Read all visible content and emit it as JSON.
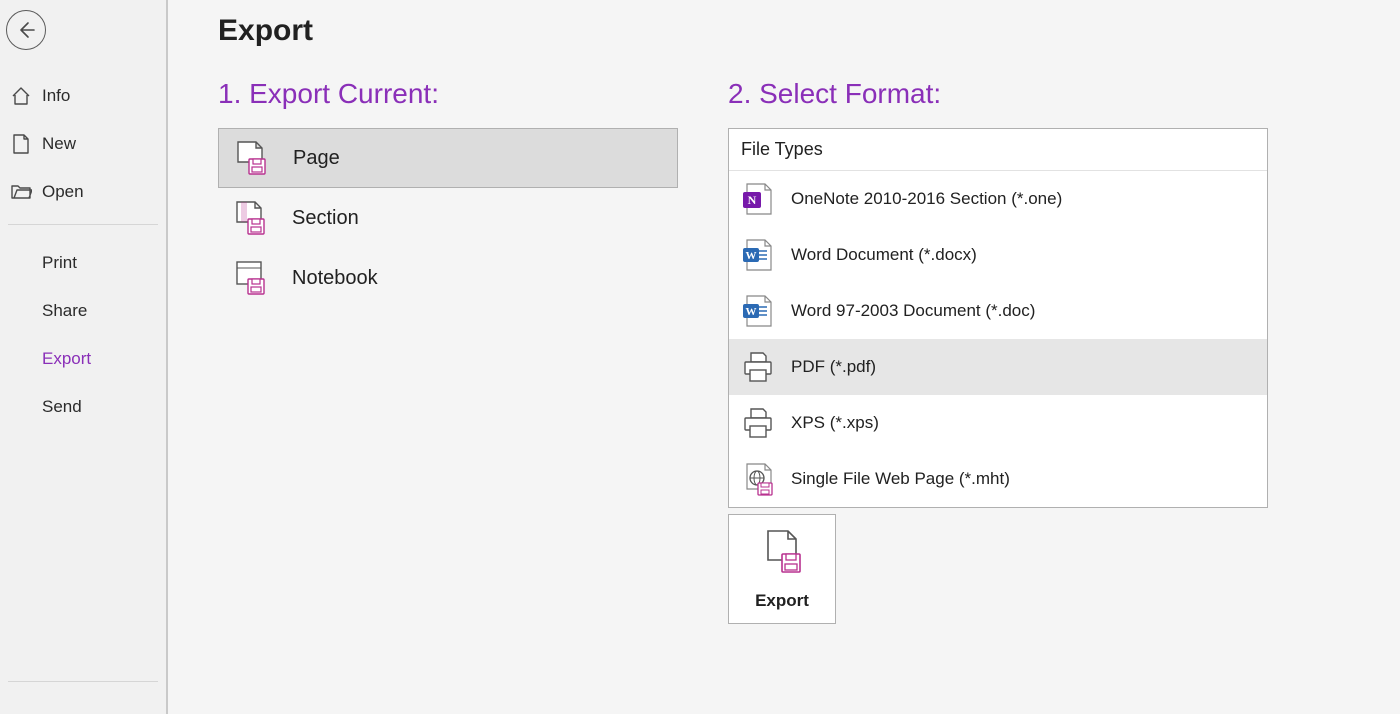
{
  "colors": {
    "accent": "#8a2fb8",
    "save_badge": "#b8318f",
    "word_blue": "#2b6ab4",
    "onenote_purple": "#7719aa"
  },
  "sidebar": {
    "items": [
      {
        "key": "info",
        "label": "Info",
        "icon": "home-icon",
        "indented": false
      },
      {
        "key": "new",
        "label": "New",
        "icon": "page-icon",
        "indented": false
      },
      {
        "key": "open",
        "label": "Open",
        "icon": "folder-icon",
        "indented": false
      },
      {
        "key": "print",
        "label": "Print",
        "icon": null,
        "indented": true
      },
      {
        "key": "share",
        "label": "Share",
        "icon": null,
        "indented": true
      },
      {
        "key": "export",
        "label": "Export",
        "icon": null,
        "indented": true,
        "active": true
      },
      {
        "key": "send",
        "label": "Send",
        "icon": null,
        "indented": true
      }
    ]
  },
  "page": {
    "title": "Export",
    "step1": {
      "heading": "1. Export Current:"
    },
    "step2": {
      "heading": "2. Select Format:",
      "group_label": "File Types"
    },
    "export_button_label": "Export"
  },
  "export_scopes": [
    {
      "key": "page",
      "label": "Page",
      "selected": true
    },
    {
      "key": "section",
      "label": "Section",
      "selected": false
    },
    {
      "key": "notebook",
      "label": "Notebook",
      "selected": false
    }
  ],
  "file_formats": [
    {
      "key": "one",
      "label": "OneNote 2010-2016 Section (*.one)",
      "icon": "onenote-file-icon",
      "selected": false
    },
    {
      "key": "docx",
      "label": "Word Document (*.docx)",
      "icon": "word-file-icon",
      "selected": false
    },
    {
      "key": "doc",
      "label": "Word 97-2003 Document (*.doc)",
      "icon": "word-file-icon",
      "selected": false
    },
    {
      "key": "pdf",
      "label": "PDF (*.pdf)",
      "icon": "printer-icon",
      "selected": true
    },
    {
      "key": "xps",
      "label": "XPS (*.xps)",
      "icon": "printer-icon",
      "selected": false
    },
    {
      "key": "mht",
      "label": "Single File Web Page (*.mht)",
      "icon": "web-file-icon",
      "selected": false
    }
  ]
}
